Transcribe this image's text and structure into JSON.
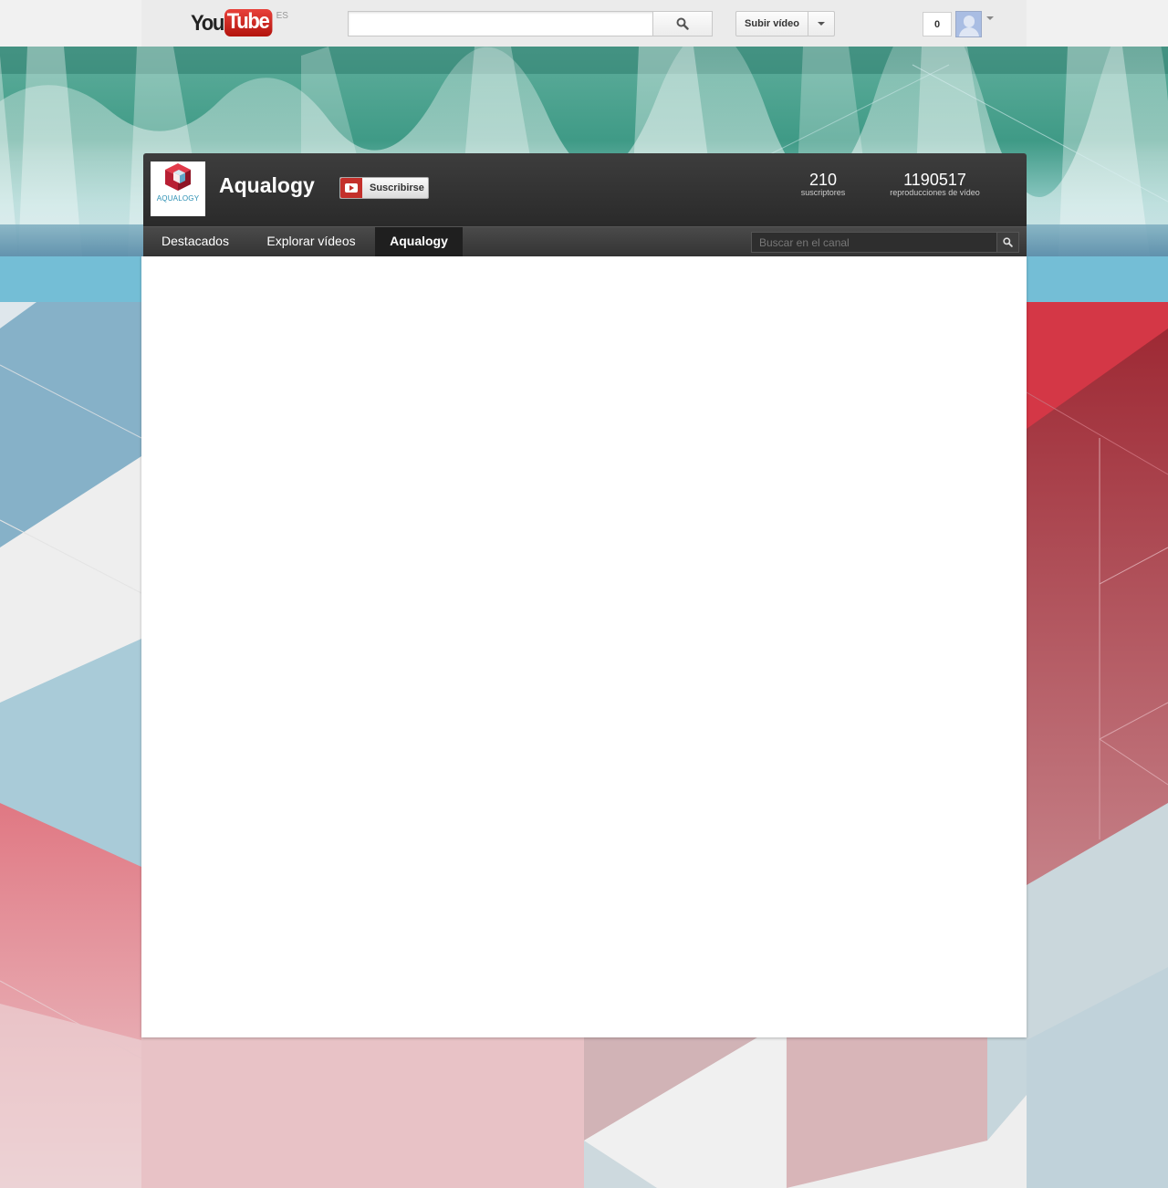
{
  "masthead": {
    "logo_you": "You",
    "logo_tube": "Tube",
    "logo_lang": "ES",
    "search_placeholder": "",
    "search_icon": "search-icon",
    "upload_label": "Subir vídeo",
    "notifications_count": "0"
  },
  "channel": {
    "name": "Aqualogy",
    "logo_caption": "AQUALOGY",
    "subscribe_label": "Suscribirse",
    "stats": {
      "subscribers": "210",
      "subscribers_label": "suscriptores",
      "views": "1190517",
      "views_label": "reproducciones de vídeo"
    },
    "tabs": [
      {
        "label": "Destacados",
        "active": false
      },
      {
        "label": "Explorar vídeos",
        "active": false
      },
      {
        "label": "Aqualogy",
        "active": true
      }
    ],
    "search_placeholder": "Buscar en el canal"
  },
  "colors": {
    "accent_red": "#c4302b",
    "band_blue": "#74bed6",
    "header_dark": "#333333"
  }
}
